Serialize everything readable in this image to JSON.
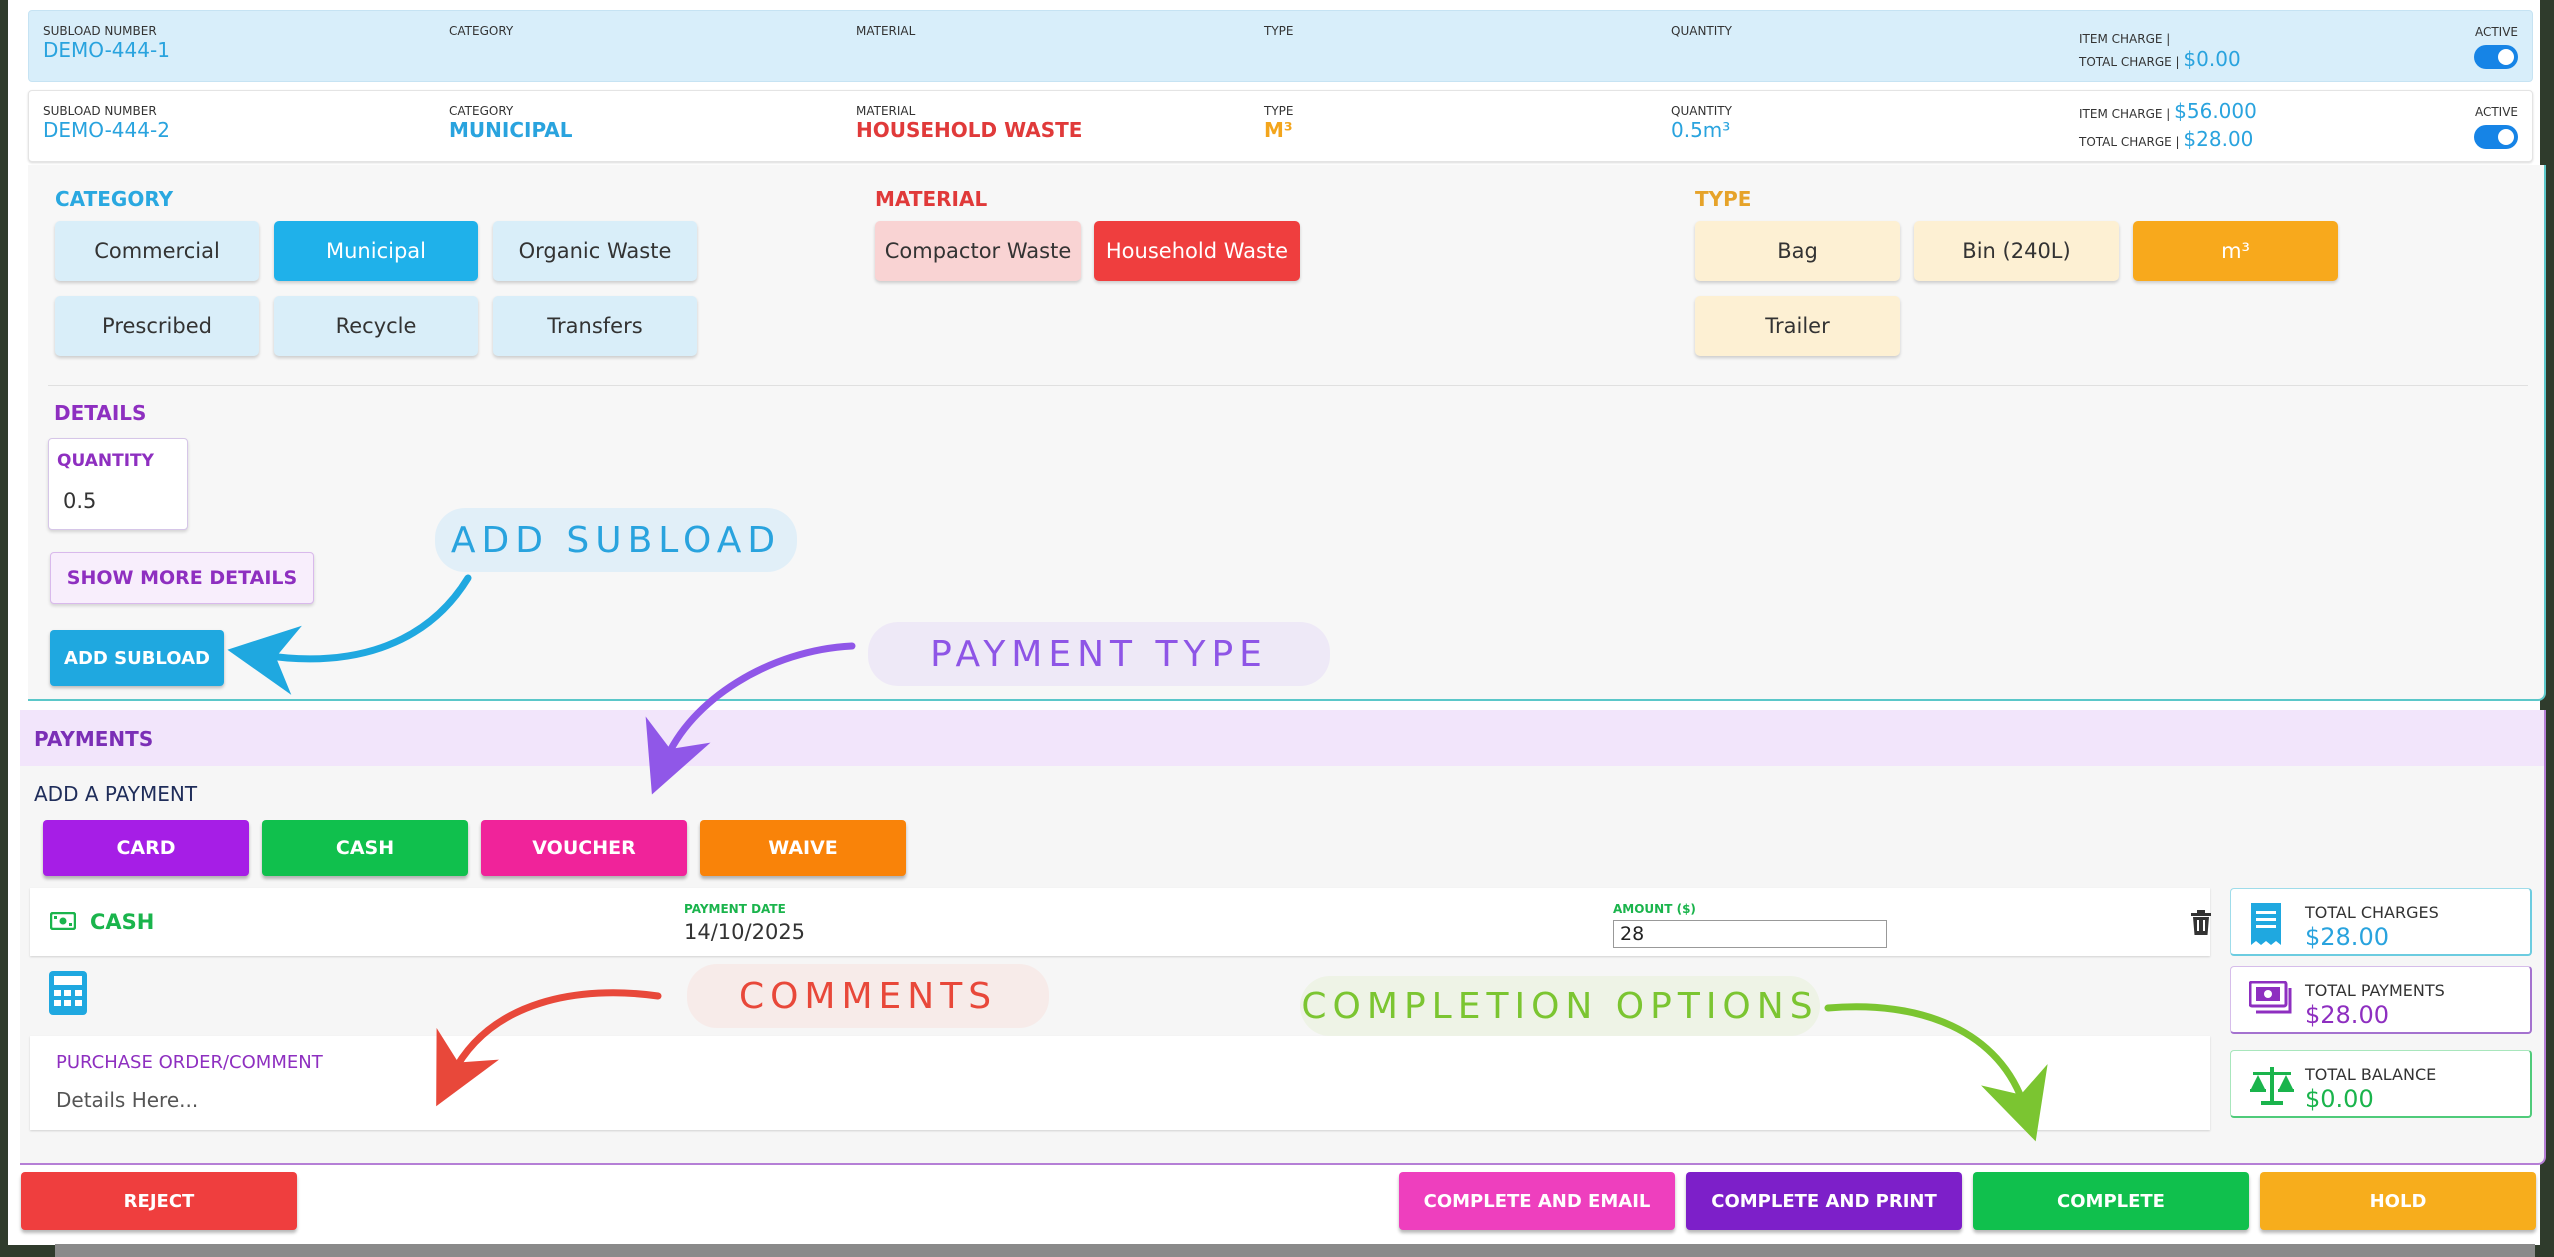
{
  "subloads": [
    {
      "labels": {
        "number": "SUBLOAD NUMBER",
        "category": "CATEGORY",
        "material": "MATERIAL",
        "type": "TYPE",
        "quantity": "QUANTITY",
        "item_charge": "ITEM CHARGE |",
        "total_charge": "TOTAL CHARGE |",
        "active": "ACTIVE"
      },
      "number": "DEMO-444-1",
      "category": "",
      "material": "",
      "type": "",
      "quantity": "",
      "item_charge": "",
      "total_charge": "$0.00",
      "active": true
    },
    {
      "labels": {
        "number": "SUBLOAD NUMBER",
        "category": "CATEGORY",
        "material": "MATERIAL",
        "type": "TYPE",
        "quantity": "QUANTITY",
        "item_charge": "ITEM CHARGE |",
        "total_charge": "TOTAL CHARGE |",
        "active": "ACTIVE"
      },
      "number": "DEMO-444-2",
      "category": "MUNICIPAL",
      "material": "HOUSEHOLD WASTE",
      "type": "M³",
      "quantity": "0.5m³",
      "item_charge": "$56.000",
      "total_charge": "$28.00",
      "active": true
    }
  ],
  "editor": {
    "category_title": "CATEGORY",
    "categories": [
      "Commercial",
      "Municipal",
      "Organic Waste",
      "Prescribed",
      "Recycle",
      "Transfers"
    ],
    "selected_category": "Municipal",
    "material_title": "MATERIAL",
    "materials": [
      "Compactor Waste",
      "Household Waste"
    ],
    "selected_material": "Household Waste",
    "type_title": "TYPE",
    "types": [
      "Bag",
      "Bin (240L)",
      "m³",
      "Trailer"
    ],
    "selected_type": "m³",
    "details_title": "DETAILS",
    "quantity_label": "QUANTITY",
    "quantity_value": "0.5",
    "show_more_label": "SHOW MORE DETAILS",
    "add_subload_label": "ADD SUBLOAD"
  },
  "payments": {
    "title": "PAYMENTS",
    "add_payment_label": "ADD A PAYMENT",
    "buttons": [
      "CARD",
      "CASH",
      "VOUCHER",
      "WAIVE"
    ],
    "entry": {
      "method": "CASH",
      "date_label": "PAYMENT DATE",
      "date": "14/10/2025",
      "amount_label": "AMOUNT ($)",
      "amount": "28"
    },
    "comment_label": "PURCHASE ORDER/COMMENT",
    "comment_placeholder": "Details Here..."
  },
  "totals": {
    "charges_label": "TOTAL CHARGES",
    "charges": "$28.00",
    "payments_label": "TOTAL PAYMENTS",
    "payments": "$28.00",
    "balance_label": "TOTAL BALANCE",
    "balance": "$0.00"
  },
  "footer": {
    "reject": "REJECT",
    "complete_email": "COMPLETE AND EMAIL",
    "complete_print": "COMPLETE AND PRINT",
    "complete": "COMPLETE",
    "hold": "HOLD"
  },
  "annotations": {
    "add_subload": "ADD SUBLOAD",
    "payment_type": "PAYMENT TYPE",
    "comments": "COMMENTS",
    "completion_options": "COMPLETION OPTIONS"
  },
  "colors": {
    "blue": "#1fb1ea",
    "red": "#ef3e3e",
    "orange": "#f8a91c",
    "purple": "#8e2fc0",
    "card": "#a61ee6",
    "cash": "#10c04d",
    "voucher": "#f0239a",
    "waive": "#f98309",
    "complete_email": "#ee3fbe",
    "complete_print": "#7d1fc9",
    "complete": "#10c04d",
    "hold": "#f7ad1c"
  },
  "icons": [
    "money-icon",
    "trash-icon",
    "calculator-icon",
    "receipt-icon",
    "cash-stack-icon",
    "scale-icon",
    "toggle-switch"
  ]
}
